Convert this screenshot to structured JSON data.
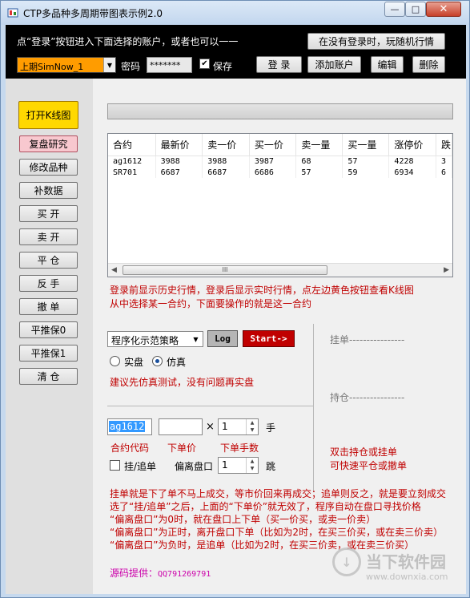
{
  "window": {
    "title": "CTP多品种多周期带图表示例2.0",
    "min_label": "—",
    "max_label": "□",
    "close_label": "✕"
  },
  "topbar": {
    "hint": "点“登录”按钮进入下面选择的账户，或者也可以一一",
    "offline_button": "在没有登录时，玩随机行情",
    "account_selected": "上期SimNow_1",
    "password_label": "密码",
    "password_value": "*******",
    "save_label": "保存",
    "save_checked": true,
    "login_button": "登 录",
    "add_account_button": "添加账户",
    "edit_button": "编辑",
    "delete_button": "删除"
  },
  "sidebar": {
    "items": [
      {
        "label": "打开K线图",
        "style": "yellow"
      },
      {
        "label": "复盘研究",
        "style": "pink"
      },
      {
        "label": "修改品种",
        "style": "normal"
      },
      {
        "label": "补数据",
        "style": "normal"
      },
      {
        "label": "买 开",
        "style": "normal"
      },
      {
        "label": "卖 开",
        "style": "normal"
      },
      {
        "label": "平 仓",
        "style": "normal"
      },
      {
        "label": "反 手",
        "style": "normal"
      },
      {
        "label": "撤 单",
        "style": "normal"
      },
      {
        "label": "平推保0",
        "style": "normal"
      },
      {
        "label": "平推保1",
        "style": "normal"
      },
      {
        "label": "清 仓",
        "style": "normal"
      }
    ]
  },
  "quotes": {
    "headers": [
      "合约",
      "最新价",
      "卖一价",
      "买一价",
      "卖一量",
      "买一量",
      "涨停价",
      "跌"
    ],
    "rows": [
      [
        "ag1612",
        "3988",
        "3988",
        "3987",
        "68",
        "57",
        "4228",
        "3"
      ],
      [
        "SR701",
        "6687",
        "6687",
        "6686",
        "57",
        "59",
        "6934",
        "6"
      ]
    ],
    "scroll_grip": "III"
  },
  "notes": {
    "line1": "登录前显示历史行情，登录后显示实时行情，点左边黄色按钮查看K线图",
    "line2": "从中选择某一合约，下面要操作的就是这一合约"
  },
  "strategy": {
    "selected": "程序化示范策略",
    "log_button": "Log",
    "start_button": "Start->",
    "mode_real": "实盘",
    "mode_sim": "仿真",
    "mode_selected": "仿真",
    "advice": "建议先仿真测试，没有问题再实盘"
  },
  "order": {
    "contract_code": "ag1612",
    "price_value": "",
    "times_sign": "×",
    "quantity": "1",
    "quantity_unit": "手",
    "code_caption": "合约代码",
    "price_caption": "下单价",
    "qty_caption": "下单手数",
    "chase_label": "挂/追单",
    "offset_label": "偏离盘口",
    "offset_value": "1",
    "offset_unit": "跳"
  },
  "right_panel": {
    "pending_label": "挂单----------------",
    "position_label": "持仓----------------",
    "hint_line1": "双击持仓或挂单",
    "hint_line2": "可快速平仓或撤单"
  },
  "explanation": [
    "挂单就是下了单不马上成交，等市价回来再成交；追单则反之，就是要立刻成交",
    "选了“挂/追单”之后，上面的“下单价”就无效了，程序自动在盘口寻找价格",
    "“偏离盘口”为0时，就在盘口上下单（买一价买，或卖一价卖）",
    "“偏离盘口”为正时，离开盘口下单（比如为2时，在买三价买，或在卖三价卖）",
    "“偏离盘口”为负时，是追单（比如为2时，在买三价卖，或在卖三价买）"
  ],
  "source": {
    "label": "源码提供：",
    "qq": "QQ791269791"
  },
  "watermark": {
    "brand": "当下软件园",
    "url": "www.downxia.com"
  },
  "colors": {
    "account_select_bg": "#ff9c00",
    "open_kline_bg": "#ffd800",
    "replay_bg": "#f8c8cf",
    "start_bg": "#c00000",
    "note_red": "#c00000",
    "source_magenta": "#cc00aa"
  }
}
